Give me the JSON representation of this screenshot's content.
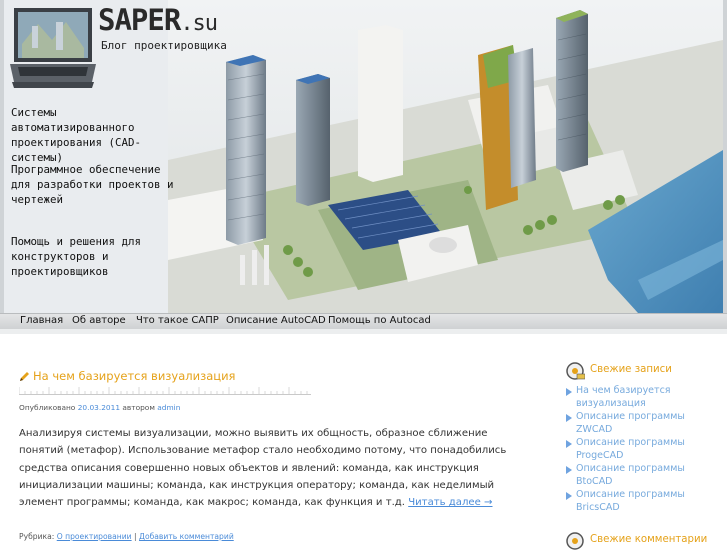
{
  "site": {
    "logo_main": "SAPER",
    "logo_suffix": ".su",
    "tagline": "Блог проектировщика",
    "slogans": [
      "Системы автоматизированного проектирования (CAD-системы)",
      "Программное обеспечение для разработки проектов и чертежей",
      "Помощь и решения для конструкторов и проектировщиков"
    ]
  },
  "nav": {
    "items": [
      {
        "label": "Главная"
      },
      {
        "label": "Об авторе"
      },
      {
        "label": "Что такое САПР"
      },
      {
        "label": "Описание AutoCAD"
      },
      {
        "label": "Помощь по Autocad"
      }
    ]
  },
  "post": {
    "title": "На чем базируется визуализация",
    "meta_prefix": "Опубликовано",
    "date": "20.03.2011",
    "author_prefix": "автором",
    "author": "admin",
    "body": "Анализируя системы визуализации, можно выявить их общность, образное сближение понятий (метафор). Использование метафор стало необходимо потому, что понадобились средства описания совершенно новых объектов и явлений: команда, как инструкция инициализации машины; команда, как инструкция оператору; команда, как неделимый элемент программы; команда, как макрос; команда, как функция и т.д.",
    "read_more": "Читать далее →",
    "category_prefix": "Рубрика:",
    "category": "О проектировании",
    "separator": "|",
    "add_comment": "Добавить комментарий"
  },
  "sidebar": {
    "recent_title": "Свежие записи",
    "recent": [
      {
        "label": "На чем базируется визуализация"
      },
      {
        "label": "Описание программы ZWCAD"
      },
      {
        "label": "Описание программы ProgeCAD"
      },
      {
        "label": "Описание программы BtoCAD"
      },
      {
        "label": "Описание программы BricsCAD"
      }
    ],
    "comments_title": "Свежие комментарии"
  },
  "colors": {
    "accent": "#e5a21a",
    "link": "#4a8bd8",
    "sidebar_link": "#77aadd"
  }
}
